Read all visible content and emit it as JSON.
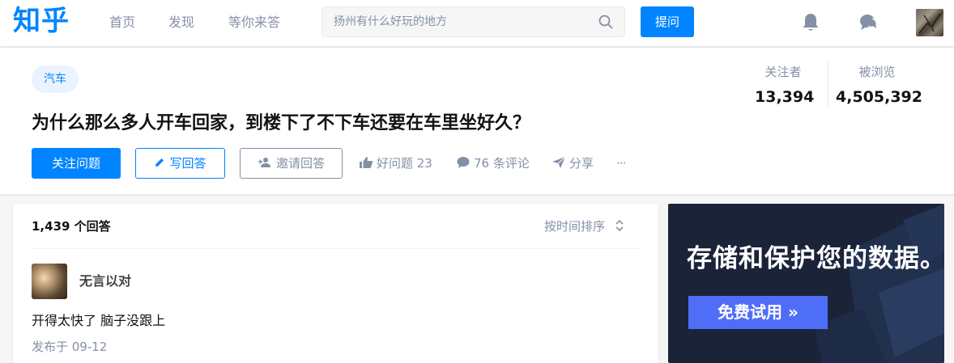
{
  "header": {
    "logo": "知乎",
    "nav": [
      "首页",
      "发现",
      "等你来答"
    ],
    "search_placeholder": "扬州有什么好玩的地方",
    "ask_label": "提问"
  },
  "question": {
    "topic": "汽车",
    "title": "为什么那么多人开车回家，到楼下了不下车还要在车里坐好久？",
    "followers_label": "关注者",
    "followers": "13,394",
    "views_label": "被浏览",
    "views": "4,505,392",
    "follow_btn": "关注问题",
    "write_btn": "写回答",
    "invite_btn": "邀请回答",
    "good_question": "好问题 23",
    "comments": "76 条评论",
    "share": "分享",
    "more": "···"
  },
  "answers": {
    "count": "1,439 个回答",
    "sort_label": "按时间排序",
    "items": [
      {
        "author": "无言以对",
        "content": "开得太快了 脑子没跟上",
        "date": "发布于 09-12"
      }
    ]
  },
  "ad": {
    "title": "存储和保护您的数据。",
    "cta": "免费试用 »"
  },
  "colors": {
    "brand": "#0084ff",
    "muted": "#8590a6",
    "ad_bg": "#1a2338",
    "ad_button": "#4f6ef7"
  },
  "icons": [
    "search-icon",
    "bell-icon",
    "message-icon",
    "pencil-icon",
    "add-user-icon",
    "thumb-up-icon",
    "comment-icon",
    "share-icon",
    "more-icon",
    "sort-icon"
  ]
}
